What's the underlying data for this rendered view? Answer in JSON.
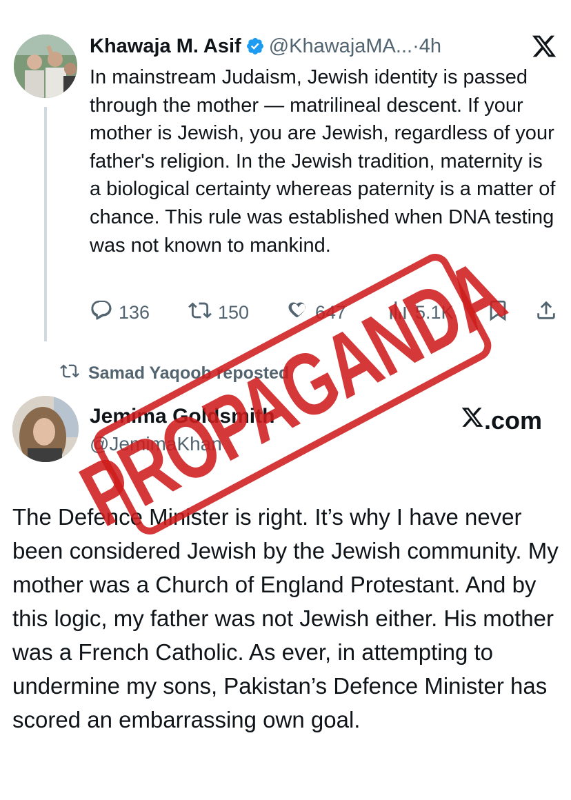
{
  "tweet1": {
    "author_name": "Khawaja M. Asif",
    "handle": "@KhawajaMA...",
    "separator": "·",
    "time": "4h",
    "text": "In mainstream Judaism, Jewish identity is passed through the mother — matrilineal descent. If your mother is Jewish, you are Jewish, regardless of your father's religion. In the Jewish tradition, maternity is a biological certainty whereas paternity is a matter of chance. This rule was established when DNA testing was not known to mankind.",
    "replies": "136",
    "reposts": "150",
    "likes": "647",
    "views": "5.1K"
  },
  "repost": {
    "text": "Samad Yaqoob reposted"
  },
  "tweet2": {
    "author_name": "Jemima Goldsmith",
    "handle": "@JemimaKhan",
    "brand": ".com",
    "text": "The Defence Minister is right. It’s why I have never been considered Jewish by the Jewish community. My mother was a Church of England Protestant. And by this logic, my father was not Jewish either. His mother was a French Catholic. As ever, in attempting to undermine my sons, Pakistan’s Defence Minister has scored an embarrassing own goal."
  },
  "stamp": {
    "text": "PROPAGANDA",
    "color": "#ce1c1c"
  },
  "colors": {
    "text": "#0f1419",
    "secondary": "#536471",
    "verified": "#1d9bf0",
    "thread_line": "#cfd9de"
  }
}
